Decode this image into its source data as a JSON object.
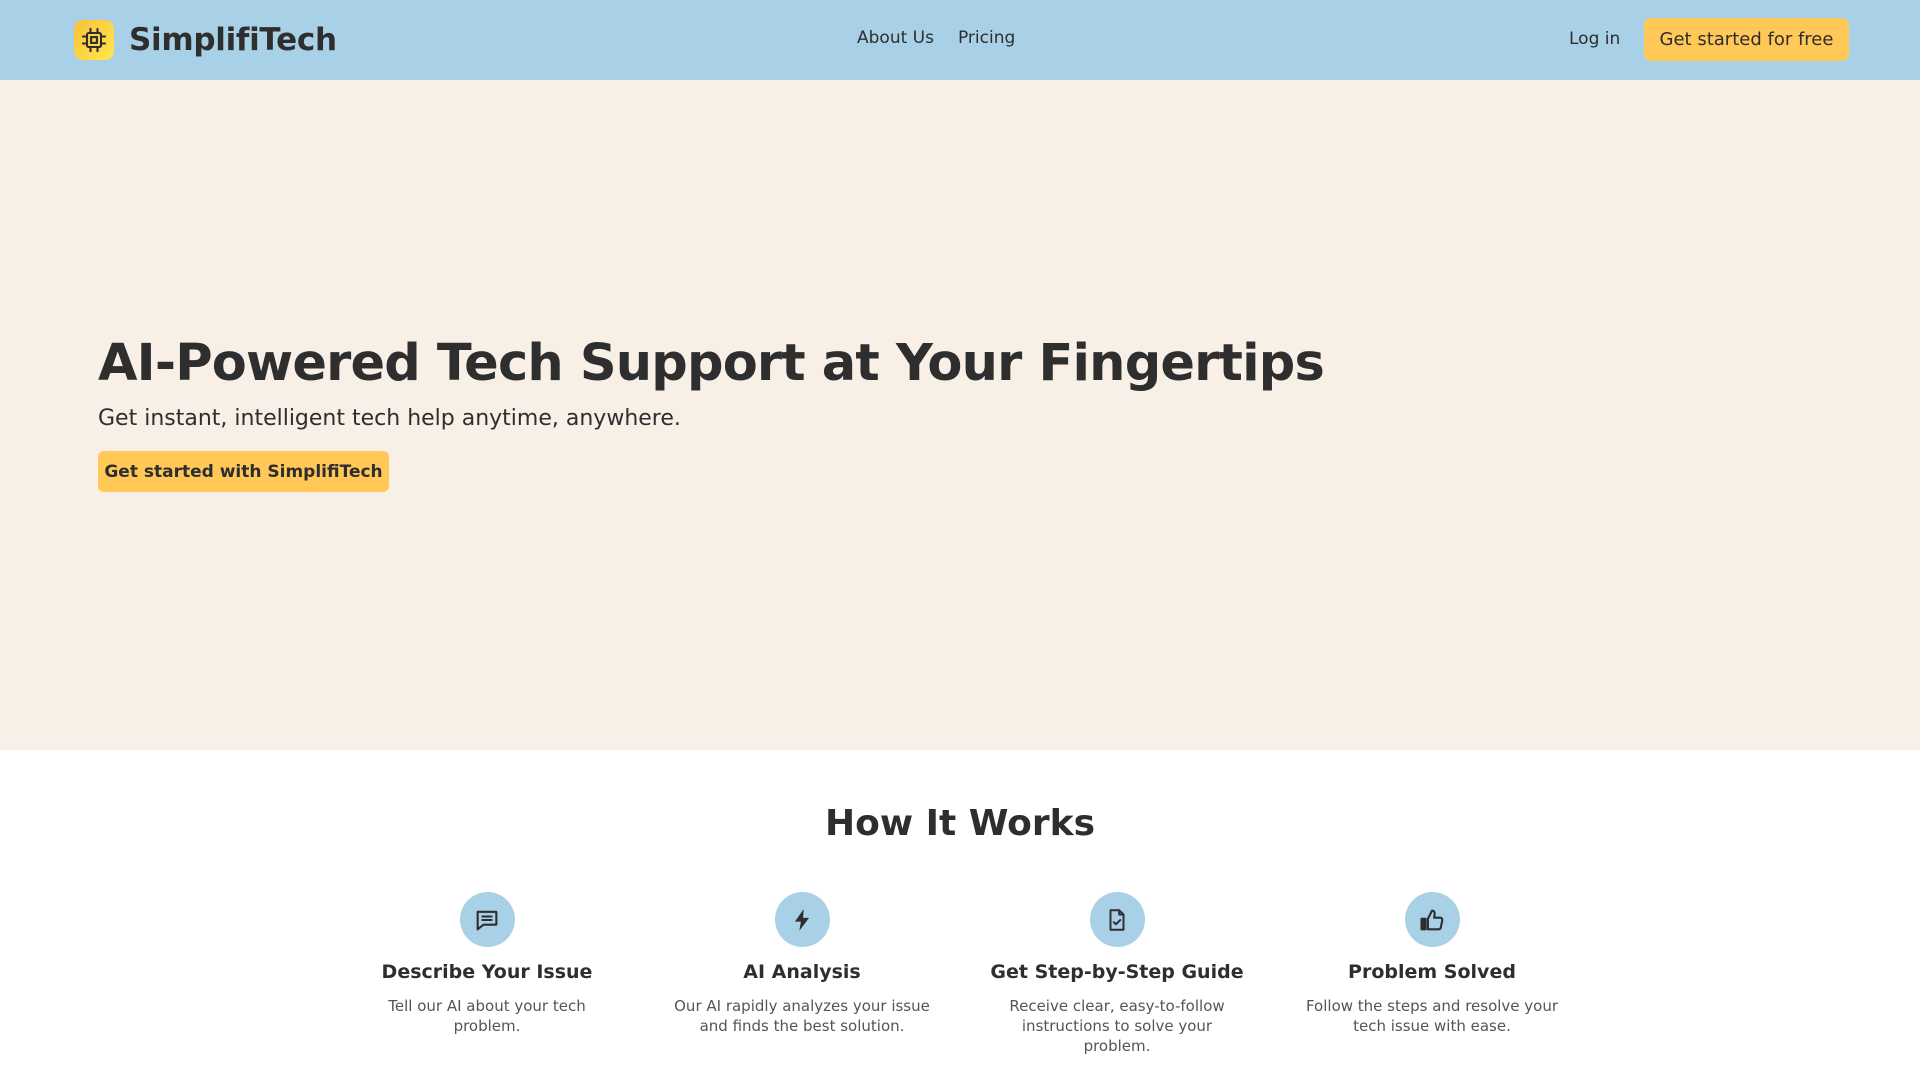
{
  "header": {
    "brand": "SimplifiTech",
    "logo_icon": "cpu-chip-icon",
    "nav": [
      {
        "label": "About Us"
      },
      {
        "label": "Pricing"
      }
    ],
    "login_label": "Log in",
    "cta_label": "Get started for free"
  },
  "hero": {
    "title": "AI-Powered Tech Support at Your Fingertips",
    "subtitle": "Get instant, intelligent tech help anytime, anywhere.",
    "cta_label": "Get started with SimplifiTech"
  },
  "how_it_works": {
    "title": "How It Works",
    "steps": [
      {
        "icon": "chat-message-icon",
        "title": "Describe Your Issue",
        "description": "Tell our AI about your tech problem."
      },
      {
        "icon": "lightning-bolt-icon",
        "title": "AI Analysis",
        "description": "Our AI rapidly analyzes your issue and finds the best solution."
      },
      {
        "icon": "document-check-icon",
        "title": "Get Step-by-Step Guide",
        "description": "Receive clear, easy-to-follow instructions to solve your problem."
      },
      {
        "icon": "thumbs-up-icon",
        "title": "Problem Solved",
        "description": "Follow the steps and resolve your tech issue with ease."
      }
    ]
  },
  "colors": {
    "header_bg": "#a8d1e7",
    "hero_bg": "#f8f0e6",
    "accent": "#ffc857",
    "text": "#2e2e2e"
  }
}
